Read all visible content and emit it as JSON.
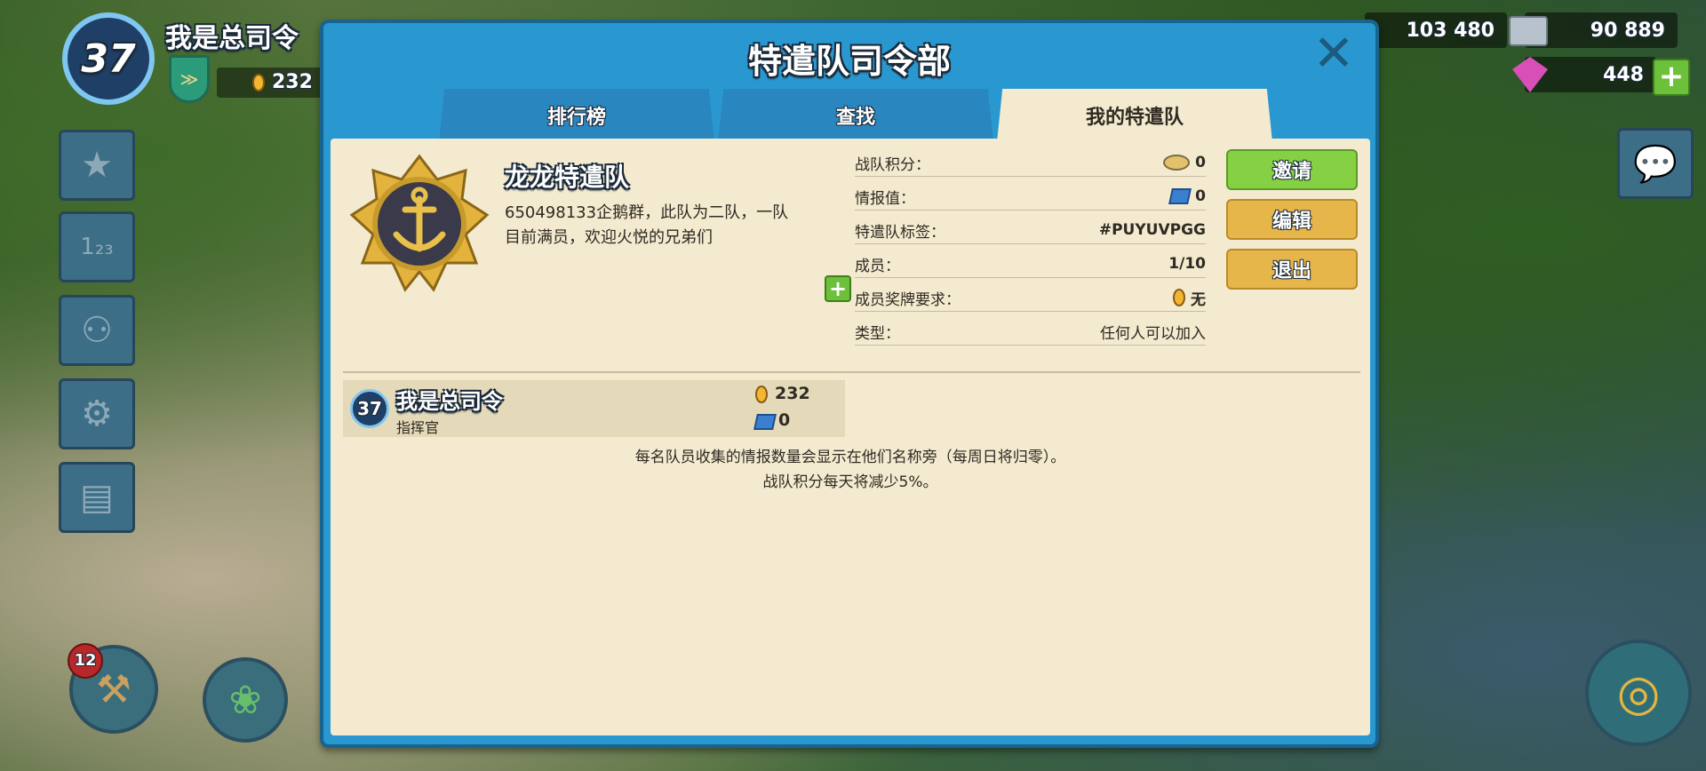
{
  "hud": {
    "level": "37",
    "player_name": "我是总司令",
    "medals": "232",
    "wood": "103 480",
    "stone": "90 889",
    "diamonds": "448",
    "builder_count": "12"
  },
  "dialog": {
    "title": "特遣队司令部",
    "tabs": [
      {
        "label": "排行榜"
      },
      {
        "label": "查找"
      },
      {
        "label": "我的特遣队"
      }
    ]
  },
  "team": {
    "name": "龙龙特遣队",
    "description": "650498133企鹅群，此队为二队，一队目前满员，欢迎火悦的兄弟们",
    "stats": [
      {
        "label": "战队积分：",
        "value": "0",
        "icon": "score-icon"
      },
      {
        "label": "情报值：",
        "value": "0",
        "icon": "intel-icon"
      },
      {
        "label": "特遣队标签：",
        "value": "#PUYUVPGG"
      },
      {
        "label": "成员：",
        "value": "1/10"
      },
      {
        "label": "成员奖牌要求：",
        "value": "无",
        "icon": "medal-icon"
      },
      {
        "label": "类型：",
        "value": "任何人可以加入"
      }
    ],
    "buttons": {
      "invite": "邀请",
      "edit": "编辑",
      "leave": "退出"
    }
  },
  "members": [
    {
      "level": "37",
      "name": "我是总司令",
      "role": "指挥官",
      "medals": "232",
      "intel": "0"
    }
  ],
  "notes": {
    "line1": "每名队员收集的情报数量会显示在他们名称旁（每周日将归零）。",
    "line2": "战队积分每天将减少5%。"
  },
  "colors": {
    "dialog_blue": "#2a98d0",
    "panel_cream": "#f3ead0",
    "button_green": "#85d143",
    "button_gold": "#e7b64a"
  }
}
